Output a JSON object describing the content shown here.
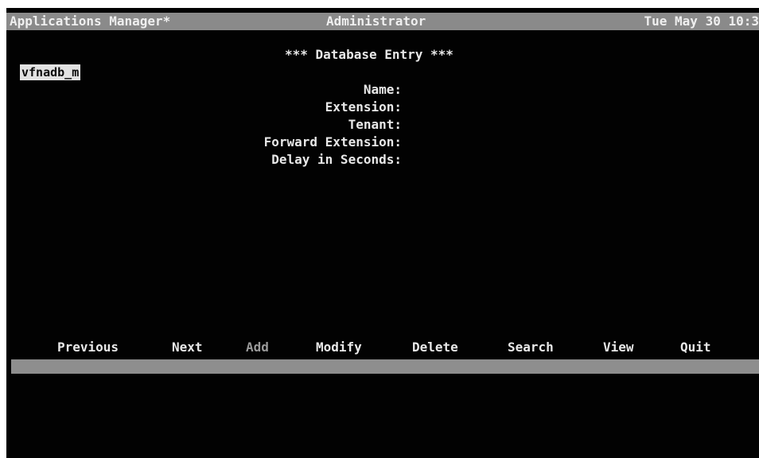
{
  "title_bar": {
    "app": "Applications Manager*",
    "user": "Administrator",
    "datetime": "Tue May 30 10:3"
  },
  "heading": "*** Database Entry ***",
  "record_id": "vfnadb_m",
  "fields": [
    {
      "label": "Name:"
    },
    {
      "label": "Extension:"
    },
    {
      "label": "Tenant:"
    },
    {
      "label": "Forward Extension:"
    },
    {
      "label": "Delay in Seconds:"
    }
  ],
  "menu": {
    "previous": "Previous",
    "next": "Next",
    "add": "Add",
    "modify": "Modify",
    "delete": "Delete",
    "search": "Search",
    "view": "View",
    "quit": "Quit"
  },
  "colors": {
    "background": "#020202",
    "text": "#e8e8e8",
    "bar": "#8a8a8a",
    "highlight": "#e2e2e2"
  }
}
